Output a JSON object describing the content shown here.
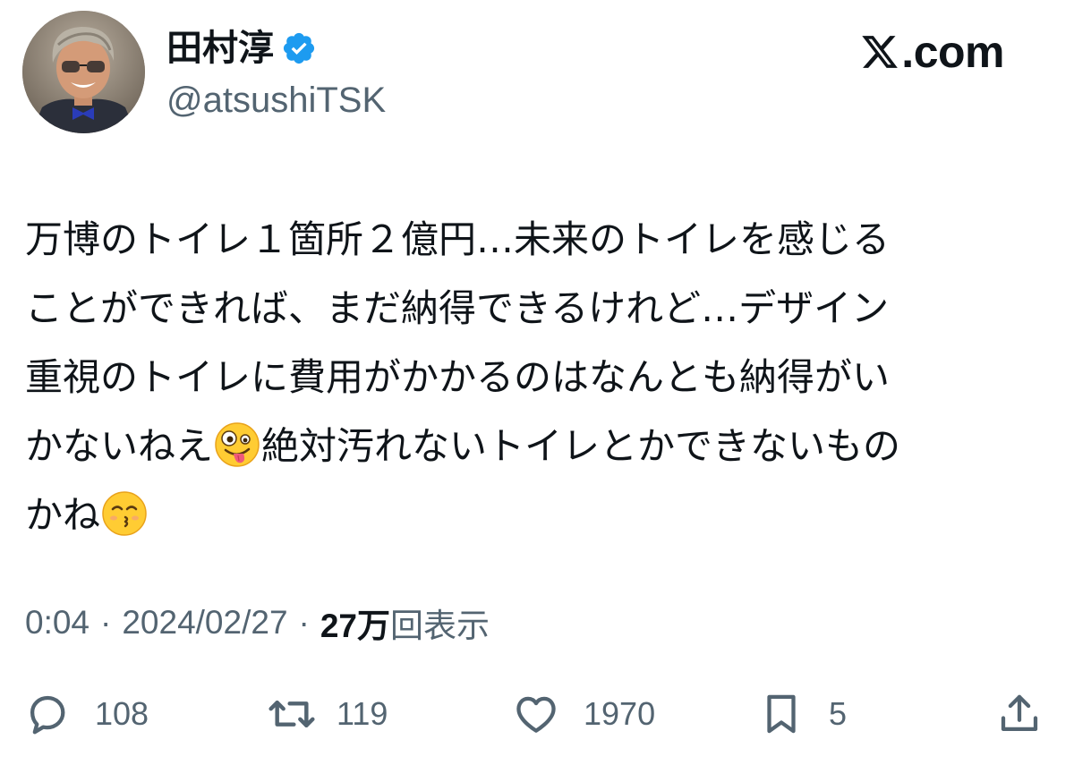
{
  "user": {
    "display_name": "田村淳",
    "handle": "@atsushiTSK",
    "verified": true,
    "avatar_icon": "profile-photo"
  },
  "brand": {
    "logo_text": ".com",
    "logo_icon": "x-logo-icon"
  },
  "tweet": {
    "lines": [
      "万博のトイレ１箇所２億円…未来のトイレを感じる",
      "ことができれば、まだ納得できるけれど…デザイン",
      "重視のトイレに費用がかかるのはなんとも納得がい"
    ],
    "line4_before_emoji": "かないねえ",
    "emoji1": "zany-face",
    "line4_after_emoji": "絶対汚れないトイレとかできないもの",
    "line5_before_emoji": "かね",
    "emoji2": "kissing-face-with-smiling-eyes"
  },
  "meta": {
    "time": "0:04",
    "separator": "·",
    "date": "2024/02/27",
    "views_count": "27万",
    "views_label": "回表示"
  },
  "actions": {
    "reply_count": "108",
    "retweet_count": "119",
    "like_count": "1970",
    "bookmark_count": "5"
  },
  "colors": {
    "text_primary": "#0f1419",
    "text_secondary": "#536471",
    "verified_blue": "#1d9bf0",
    "background": "#ffffff"
  }
}
